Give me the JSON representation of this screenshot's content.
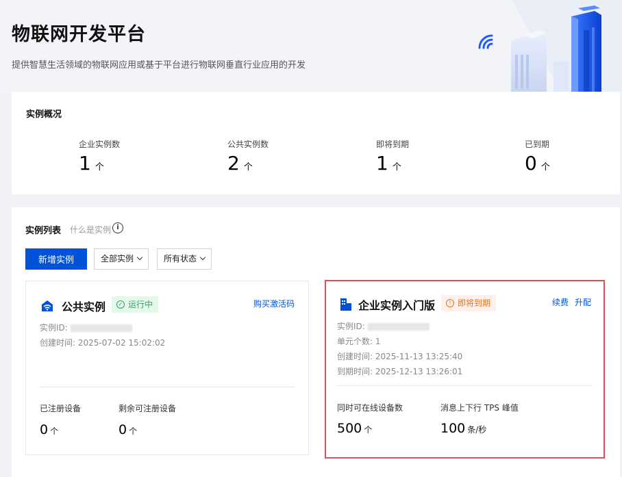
{
  "header": {
    "title": "物联网开发平台",
    "subtitle": "提供智慧生活领域的物联网应用或基于平台进行物联网垂直行业应用的开发"
  },
  "overview": {
    "title": "实例概况",
    "stats": [
      {
        "label": "企业实例数",
        "value": "1",
        "unit": "个"
      },
      {
        "label": "公共实例数",
        "value": "2",
        "unit": "个"
      },
      {
        "label": "即将到期",
        "value": "1",
        "unit": "个"
      },
      {
        "label": "已到期",
        "value": "0",
        "unit": "个"
      }
    ]
  },
  "list": {
    "title": "实例列表",
    "help_text": "什么是实例",
    "help_icon": "i",
    "new_button": "新增实例",
    "filter_type": "全部实例",
    "filter_status": "所有状态"
  },
  "public_instance": {
    "name": "公共实例",
    "status": "运行中",
    "action": "购买激活码",
    "id_label": "实例ID:",
    "created": "创建时间:  2025-07-02 15:02:02",
    "registered_label": "已注册设备",
    "registered_value": "0",
    "remaining_label": "剩余可注册设备",
    "remaining_value": "0",
    "unit": "个"
  },
  "enterprise_instance": {
    "name": "企业实例入门版",
    "status": "即将到期",
    "renew": "续费",
    "upgrade": "升配",
    "id_label": "实例ID:",
    "units": "单元个数:  1",
    "created": "创建时间:  2025-11-13 13:25:40",
    "expires": "到期时间:  2025-12-13 13:26:01",
    "online_label": "同时可在线设备数",
    "online_value": "500",
    "online_unit": "个",
    "tps_label": "消息上下行 TPS 峰值",
    "tps_value": "100",
    "tps_unit": "条/秒"
  },
  "colors": {
    "primary": "#0052d9",
    "running": "#2ba471",
    "warning": "#e37318",
    "highlight": "#e34d59"
  }
}
